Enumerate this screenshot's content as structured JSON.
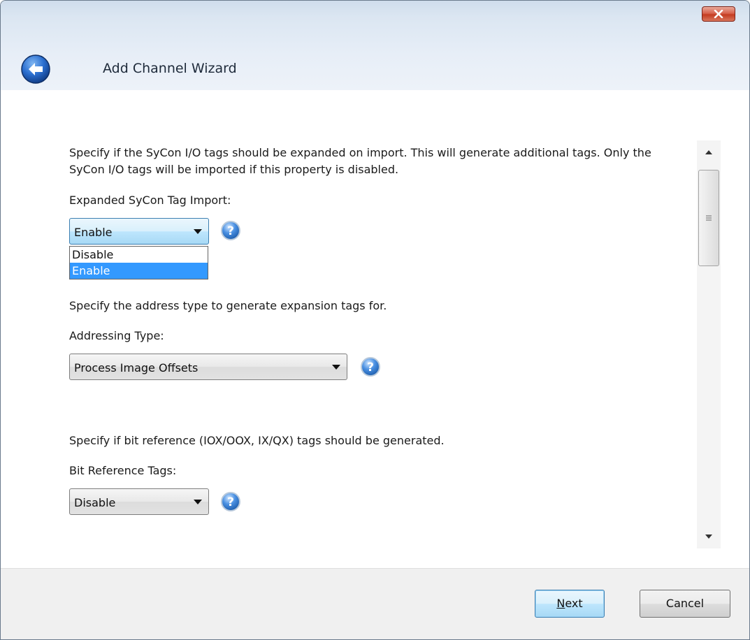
{
  "window": {
    "title": "Add Channel Wizard"
  },
  "sections": [
    {
      "description": "Specify if the SyCon I/O tags should be expanded on import. This will generate additional tags. Only the SyCon I/O tags will be imported if this property is disabled.",
      "label": "Expanded SyCon Tag Import:",
      "value": "Enable",
      "options": [
        "Disable",
        "Enable"
      ],
      "selected_option": "Enable",
      "dropdown_open": true
    },
    {
      "description": "Specify the address type to generate expansion tags for.",
      "label": "Addressing Type:",
      "value": "Process Image Offsets"
    },
    {
      "description": "Specify if bit reference (IOX/OOX, IX/QX) tags should be generated.",
      "label": "Bit Reference Tags:",
      "value": "Disable"
    }
  ],
  "footer": {
    "next_label_mnemonic": "N",
    "next_label_rest": "ext",
    "cancel_label": "Cancel"
  },
  "colors": {
    "selection": "#3399ff",
    "close_button": "#c43c21",
    "help_icon": "#2f7fd6",
    "back_button": "#1f5fbf"
  },
  "icons": {
    "back": "back-arrow-icon",
    "close": "close-icon",
    "help": "help-icon",
    "dropdown": "chevron-down-icon"
  }
}
